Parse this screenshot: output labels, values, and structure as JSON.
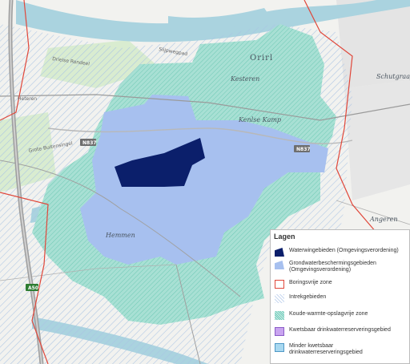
{
  "map": {
    "places": {
      "oriel": "Orirl",
      "kesteren": "Kesteren",
      "kenlse_kamp": "Kenlse Kamp",
      "schutgraaf": "Schutgraaf",
      "hemmen": "Hemmen",
      "angeren": "Angeren"
    },
    "roads": {
      "n837_a": "N837",
      "n837_b": "N837",
      "a50": "A50",
      "heteren": "Heteren",
      "drielse_rondeel": "Drielse Rondeel",
      "grote_buitensingel": "Grote Buitensingel",
      "slijpwegpad": "Slijpwegpad"
    }
  },
  "legend": {
    "title": "Lagen",
    "items": [
      {
        "label": "Waterwingebieden (Omgevingsverordening)",
        "color": "#0b1f6b",
        "kind": "polygon"
      },
      {
        "label": "Grondwaterbeschermingsgebieden (Omgevingsverordening)",
        "color": "#a7c0ef",
        "kind": "polygon"
      },
      {
        "label": "Boringsvrije zone",
        "color": "#e0473a",
        "kind": "outline"
      },
      {
        "label": "Intrekgebieden",
        "color": "#c8d8f0",
        "kind": "hatch"
      },
      {
        "label": "Koude-warmte-opslagvrije zone",
        "color": "#6cc9b8",
        "kind": "hatch"
      },
      {
        "label": "Kwetsbaar drinkwaterreserveringsgebied",
        "color": "#b88ce6",
        "kind": "fill"
      },
      {
        "label": "Minder kwetsbaar drinkwaterreserveringsgebied",
        "color": "#a8d8f0",
        "kind": "fill"
      }
    ]
  }
}
